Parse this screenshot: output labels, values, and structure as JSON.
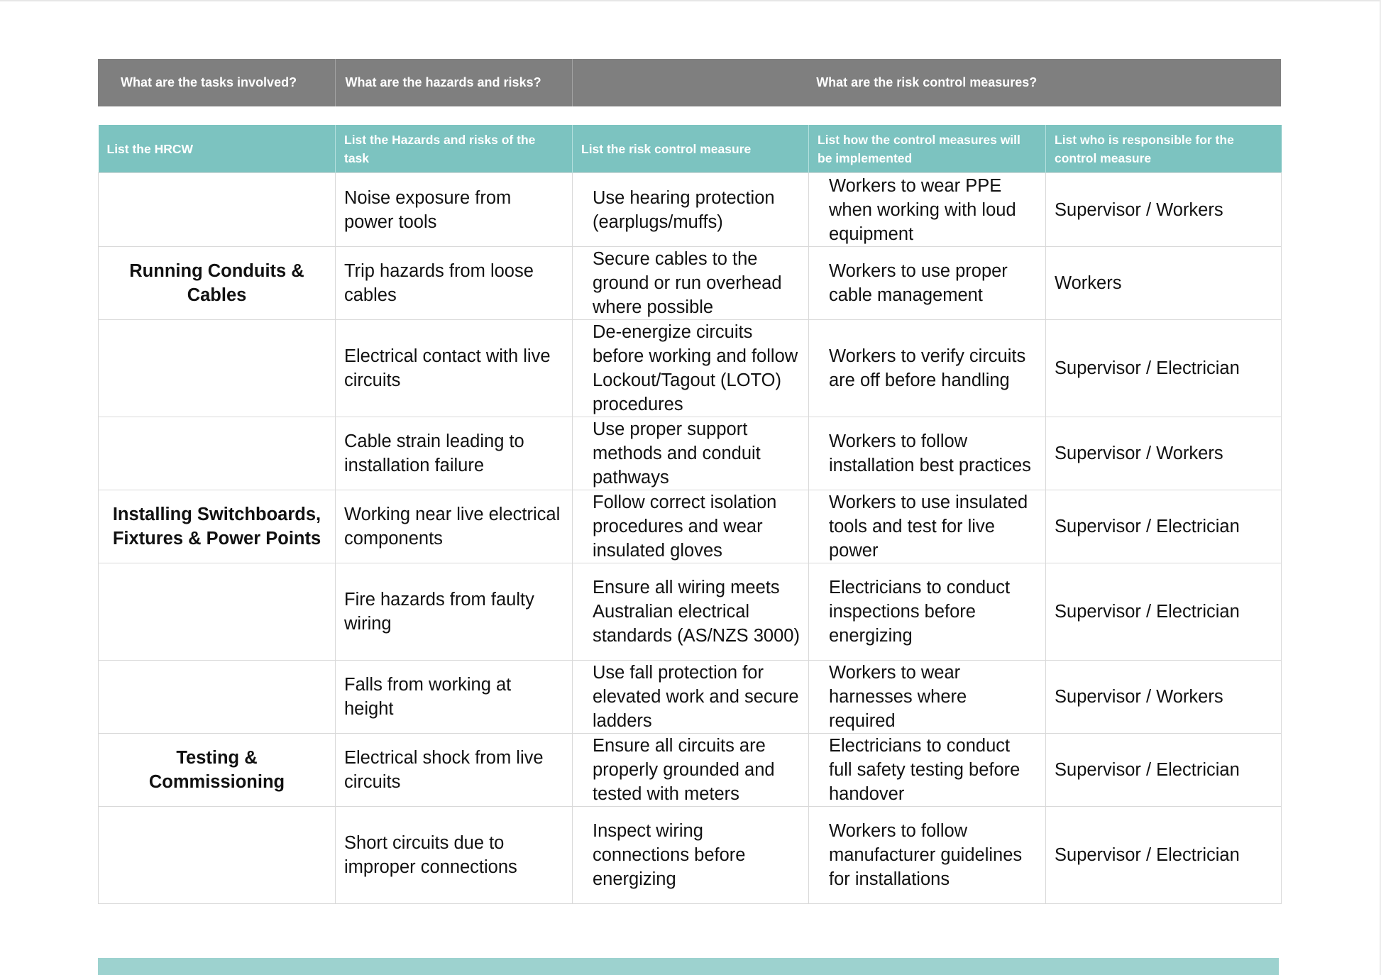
{
  "top_header": {
    "tasks": "What are the tasks involved?",
    "hazards": "What are the hazards and risks?",
    "controls": "What are the risk control measures?"
  },
  "column_headers": {
    "hrcw": "List the HRCW",
    "hazards": "List the Hazards and risks of the task",
    "control": "List the risk control measure",
    "implementation": "List how the control measures will be implemented",
    "responsible": "List who is responsible for the control measure"
  },
  "rows": [
    {
      "task": "",
      "hazard": "Noise exposure from power tools",
      "control": "Use hearing protection (earplugs/muffs)",
      "implementation": "Workers to wear PPE when working with loud equipment",
      "responsible": "Supervisor / Workers"
    },
    {
      "task": "Running Conduits & Cables",
      "hazard": "Trip hazards from loose cables",
      "control": "Secure cables to the ground or run overhead where possible",
      "implementation": "Workers to use proper cable management",
      "responsible": "Workers"
    },
    {
      "task": "",
      "hazard": "Electrical contact with live circuits",
      "control": "De-energize circuits before working and follow Lockout/Tagout (LOTO) procedures",
      "implementation": "Workers to verify circuits are off before handling",
      "responsible": "Supervisor / Electrician"
    },
    {
      "task": "",
      "hazard": "Cable strain leading to installation failure",
      "control": "Use proper support methods and conduit pathways",
      "implementation": "Workers to follow installation best practices",
      "responsible": "Supervisor / Workers"
    },
    {
      "task": "Installing Switchboards, Fixtures & Power Points",
      "hazard": "Working near live electrical components",
      "control": "Follow correct isolation procedures and wear insulated gloves",
      "implementation": "Workers to use insulated tools and test for live power",
      "responsible": "Supervisor / Electrician"
    },
    {
      "task": "",
      "hazard": "Fire hazards from faulty wiring",
      "control": "Ensure all wiring meets Australian electrical standards (AS/NZS 3000)",
      "implementation": "Electricians to conduct inspections before energizing",
      "responsible": "Supervisor / Electrician"
    },
    {
      "task": "",
      "hazard": "Falls from working at height",
      "control": "Use fall protection for elevated work and secure ladders",
      "implementation": "Workers to wear harnesses where required",
      "responsible": "Supervisor / Workers"
    },
    {
      "task": "Testing & Commissioning",
      "hazard": "Electrical shock from live circuits",
      "control": "Ensure all circuits are properly grounded and tested with meters",
      "implementation": "Electricians to conduct full safety testing before handover",
      "responsible": "Supervisor / Electrician"
    },
    {
      "task": "",
      "hazard": "Short circuits due to improper connections",
      "control": "Inspect wiring connections before energizing",
      "implementation": "Workers to follow manufacturer guidelines for installations",
      "responsible": "Supervisor / Electrician"
    }
  ],
  "colors": {
    "top_header_bg": "#7f7f7f",
    "column_header_bg": "#7cc3c0",
    "footer_bar": "#9dd2cf"
  }
}
